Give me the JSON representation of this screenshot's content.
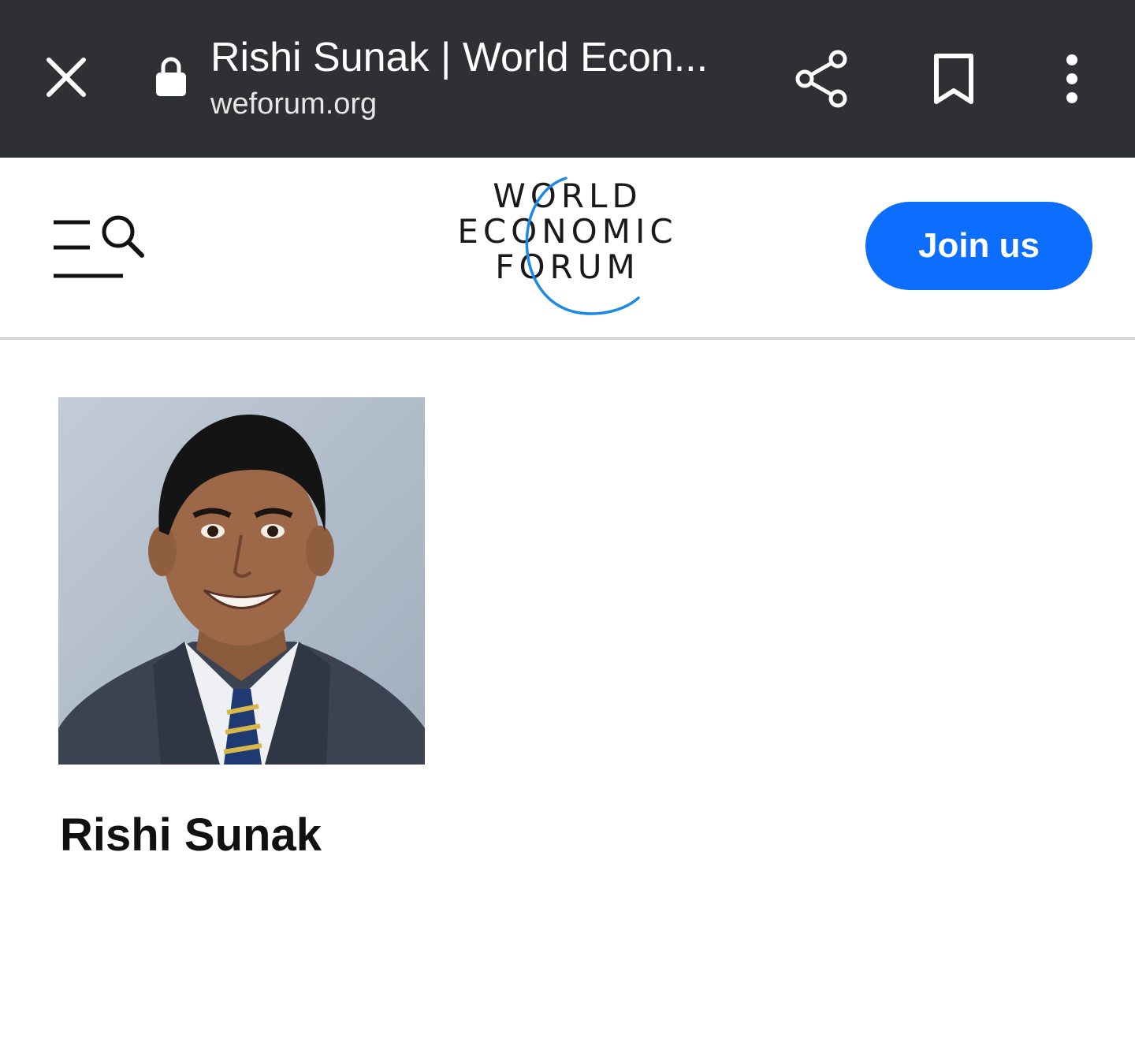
{
  "browser": {
    "page_title": "Rishi Sunak | World Econ...",
    "domain": "weforum.org",
    "icons": {
      "close": "close-icon",
      "lock": "lock-icon",
      "share": "share-icon",
      "bookmark": "bookmark-icon",
      "more": "more-vert-icon"
    }
  },
  "header": {
    "menu_icon": "menu-search-icon",
    "logo_lines": [
      "WORLD",
      "ECONOMIC",
      "FORUM"
    ],
    "join_label": "Join us",
    "accent_color": "#0d6efd",
    "logo_arc_color": "#1e88e5"
  },
  "profile": {
    "name": "Rishi Sunak",
    "photo_alt": "Portrait of Rishi Sunak"
  }
}
